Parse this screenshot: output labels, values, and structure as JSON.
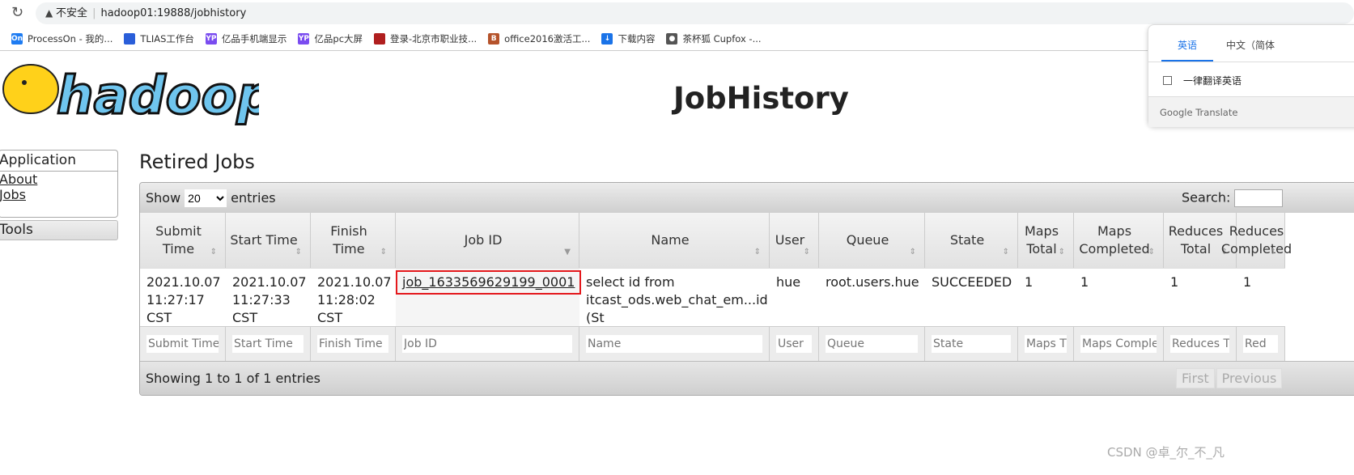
{
  "browser": {
    "security": "不安全",
    "url": "hadoop01:19888/jobhistory",
    "bookmarks": [
      {
        "label": "ProcessOn - 我的...",
        "icon": "On",
        "color": "#1e7cf2"
      },
      {
        "label": "TLIAS工作台",
        "icon": "",
        "color": "#2a5ed9"
      },
      {
        "label": "亿品手机端显示",
        "icon": "YP",
        "color": "#7a4cf0"
      },
      {
        "label": "亿品pc大屏",
        "icon": "YP",
        "color": "#7a4cf0"
      },
      {
        "label": "登录-北京市职业技...",
        "icon": "",
        "color": "#b01f1f"
      },
      {
        "label": "office2016激活工...",
        "icon": "B",
        "color": "#b5532b"
      },
      {
        "label": "下载内容",
        "icon": "↓",
        "color": "#1a73e8"
      },
      {
        "label": "茶杯狐 Cupfox -...",
        "icon": "●",
        "color": "#555"
      }
    ]
  },
  "translate": {
    "tabs": [
      "英语",
      "中文（简体"
    ],
    "option": "一律翻译英语",
    "brand": "Google Translate"
  },
  "header": {
    "logo_text": "hadoop",
    "title": "JobHistory"
  },
  "sidebar": {
    "application": "Application",
    "links": [
      "About",
      "Jobs"
    ],
    "tools": "Tools"
  },
  "main": {
    "heading": "Retired Jobs",
    "show_label": "Show",
    "entries_label": "entries",
    "page_size": "20",
    "search_label": "Search:",
    "columns": [
      "Submit Time",
      "Start Time",
      "Finish Time",
      "Job ID",
      "Name",
      "User",
      "Queue",
      "State",
      "Maps Total",
      "Maps Completed",
      "Reduces Total",
      "Reduces Completed"
    ],
    "rows": [
      [
        "2021.10.07 11:27:17 CST",
        "2021.10.07 11:27:33 CST",
        "2021.10.07 11:28:02 CST",
        "job_1633569629199_0001",
        "select id from itcast_ods.web_chat_em...id (St",
        "hue",
        "root.users.hue",
        "SUCCEEDED",
        "1",
        "1",
        "1",
        "1"
      ]
    ],
    "filters": [
      "Submit Time",
      "Start Time",
      "Finish Time",
      "Job ID",
      "Name",
      "User",
      "Queue",
      "State",
      "Maps T",
      "Maps Comple",
      "Reduces T",
      "Red"
    ],
    "footer": "Showing 1 to 1 of 1 entries",
    "pager": [
      "First",
      "Previous"
    ]
  },
  "watermark": "CSDN @卓_尔_不_凡"
}
